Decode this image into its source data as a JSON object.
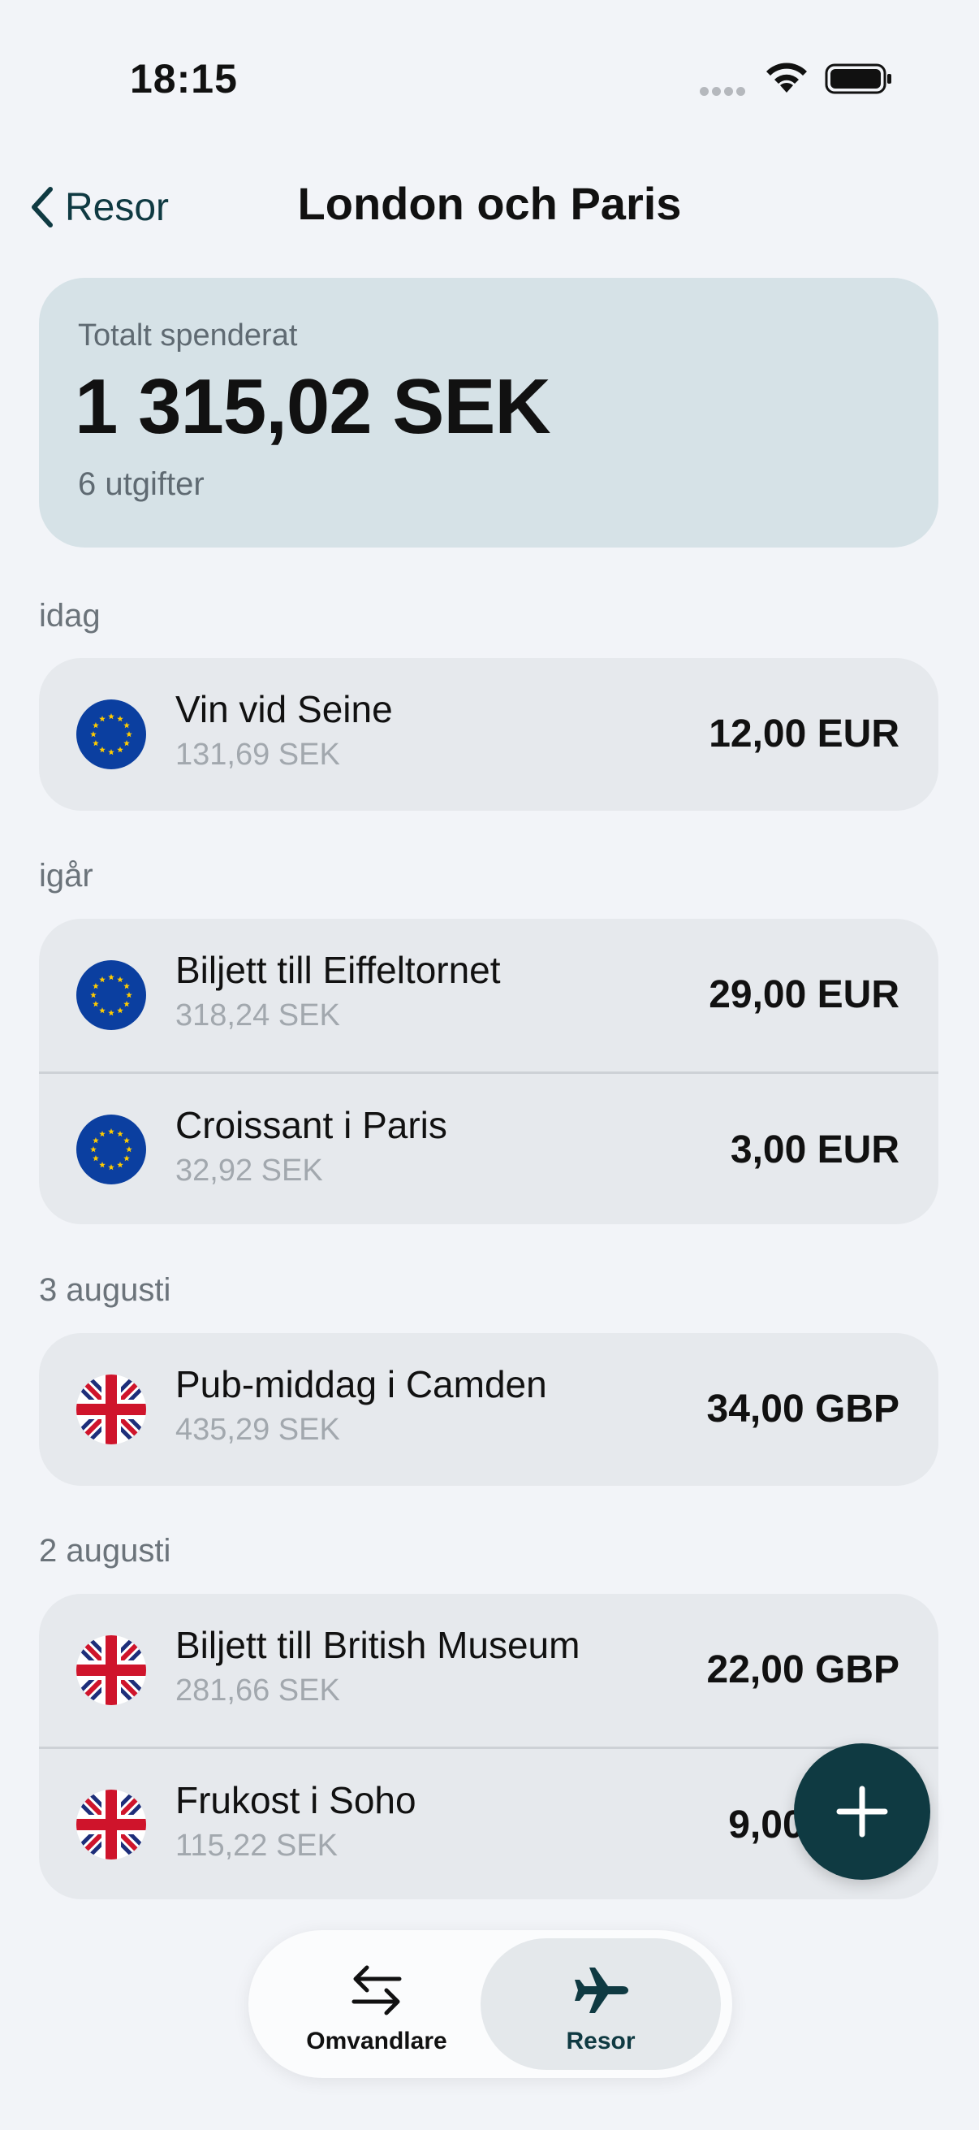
{
  "status_bar": {
    "time": "18:15"
  },
  "nav": {
    "back_label": "Resor",
    "title": "London och Paris"
  },
  "summary": {
    "label": "Totalt spenderat",
    "amount": "1 315,02 SEK",
    "count": "6 utgifter"
  },
  "sections": [
    {
      "header": "idag",
      "items": [
        {
          "flag": "eu-flag-icon",
          "title": "Vin vid Seine",
          "converted": "131,69 SEK",
          "amount": "12,00 EUR"
        }
      ]
    },
    {
      "header": "igår",
      "items": [
        {
          "flag": "eu-flag-icon",
          "title": "Biljett till Eiffeltornet",
          "converted": "318,24 SEK",
          "amount": "29,00 EUR"
        },
        {
          "flag": "eu-flag-icon",
          "title": "Croissant i Paris",
          "converted": "32,92 SEK",
          "amount": "3,00 EUR"
        }
      ]
    },
    {
      "header": "3 augusti",
      "items": [
        {
          "flag": "uk-flag-icon",
          "title": "Pub-middag i Camden",
          "converted": "435,29 SEK",
          "amount": "34,00 GBP"
        }
      ]
    },
    {
      "header": "2 augusti",
      "items": [
        {
          "flag": "uk-flag-icon",
          "title": "Biljett till British Museum",
          "converted": "281,66 SEK",
          "amount": "22,00 GBP"
        },
        {
          "flag": "uk-flag-icon",
          "title": "Frukost i Soho",
          "converted": "115,22 SEK",
          "amount": "9,00 GBP"
        }
      ]
    }
  ],
  "fab": {
    "icon": "plus-icon"
  },
  "tab_bar": {
    "tabs": [
      {
        "label": "Omvandlare",
        "icon": "swap-arrows-icon",
        "selected": false
      },
      {
        "label": "Resor",
        "icon": "airplane-icon",
        "selected": true
      }
    ]
  },
  "colors": {
    "accent": "#0f3a42",
    "background": "#f2f4f8",
    "summary_card": "#d6e2e7",
    "group_card": "#e6e9ed"
  }
}
